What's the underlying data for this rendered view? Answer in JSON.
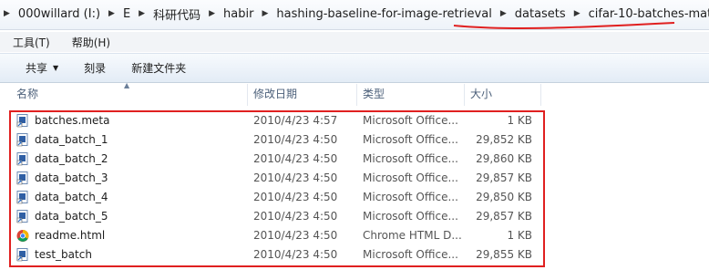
{
  "breadcrumb": {
    "items": [
      "000willard (I:)",
      "E",
      "科研代码",
      "habir",
      "hashing-baseline-for-image-retrieval",
      "datasets",
      "cifar-10-batches-mat"
    ]
  },
  "menu": {
    "items": [
      "工具(T)",
      "帮助(H)"
    ]
  },
  "toolbar": {
    "share_label": "共享",
    "burn_label": "刻录",
    "new_folder_label": "新建文件夹"
  },
  "columns": {
    "name": "名称",
    "date": "修改日期",
    "type": "类型",
    "size": "大小"
  },
  "files": [
    {
      "name": "batches.meta",
      "date": "2010/4/23 4:57",
      "type": "Microsoft Office...",
      "size": "1 KB",
      "icon": "file-shortcut-icon"
    },
    {
      "name": "data_batch_1",
      "date": "2010/4/23 4:50",
      "type": "Microsoft Office...",
      "size": "29,852 KB",
      "icon": "file-shortcut-icon"
    },
    {
      "name": "data_batch_2",
      "date": "2010/4/23 4:50",
      "type": "Microsoft Office...",
      "size": "29,860 KB",
      "icon": "file-shortcut-icon"
    },
    {
      "name": "data_batch_3",
      "date": "2010/4/23 4:50",
      "type": "Microsoft Office...",
      "size": "29,857 KB",
      "icon": "file-shortcut-icon"
    },
    {
      "name": "data_batch_4",
      "date": "2010/4/23 4:50",
      "type": "Microsoft Office...",
      "size": "29,850 KB",
      "icon": "file-shortcut-icon"
    },
    {
      "name": "data_batch_5",
      "date": "2010/4/23 4:50",
      "type": "Microsoft Office...",
      "size": "29,857 KB",
      "icon": "file-shortcut-icon"
    },
    {
      "name": "readme.html",
      "date": "2010/4/23 4:50",
      "type": "Chrome HTML D...",
      "size": "1 KB",
      "icon": "chrome-icon"
    },
    {
      "name": "test_batch",
      "date": "2010/4/23 4:50",
      "type": "Microsoft Office...",
      "size": "29,855 KB",
      "icon": "file-shortcut-icon"
    }
  ],
  "colors": {
    "highlight_box": "#e02020",
    "header_text": "#4c607a"
  }
}
